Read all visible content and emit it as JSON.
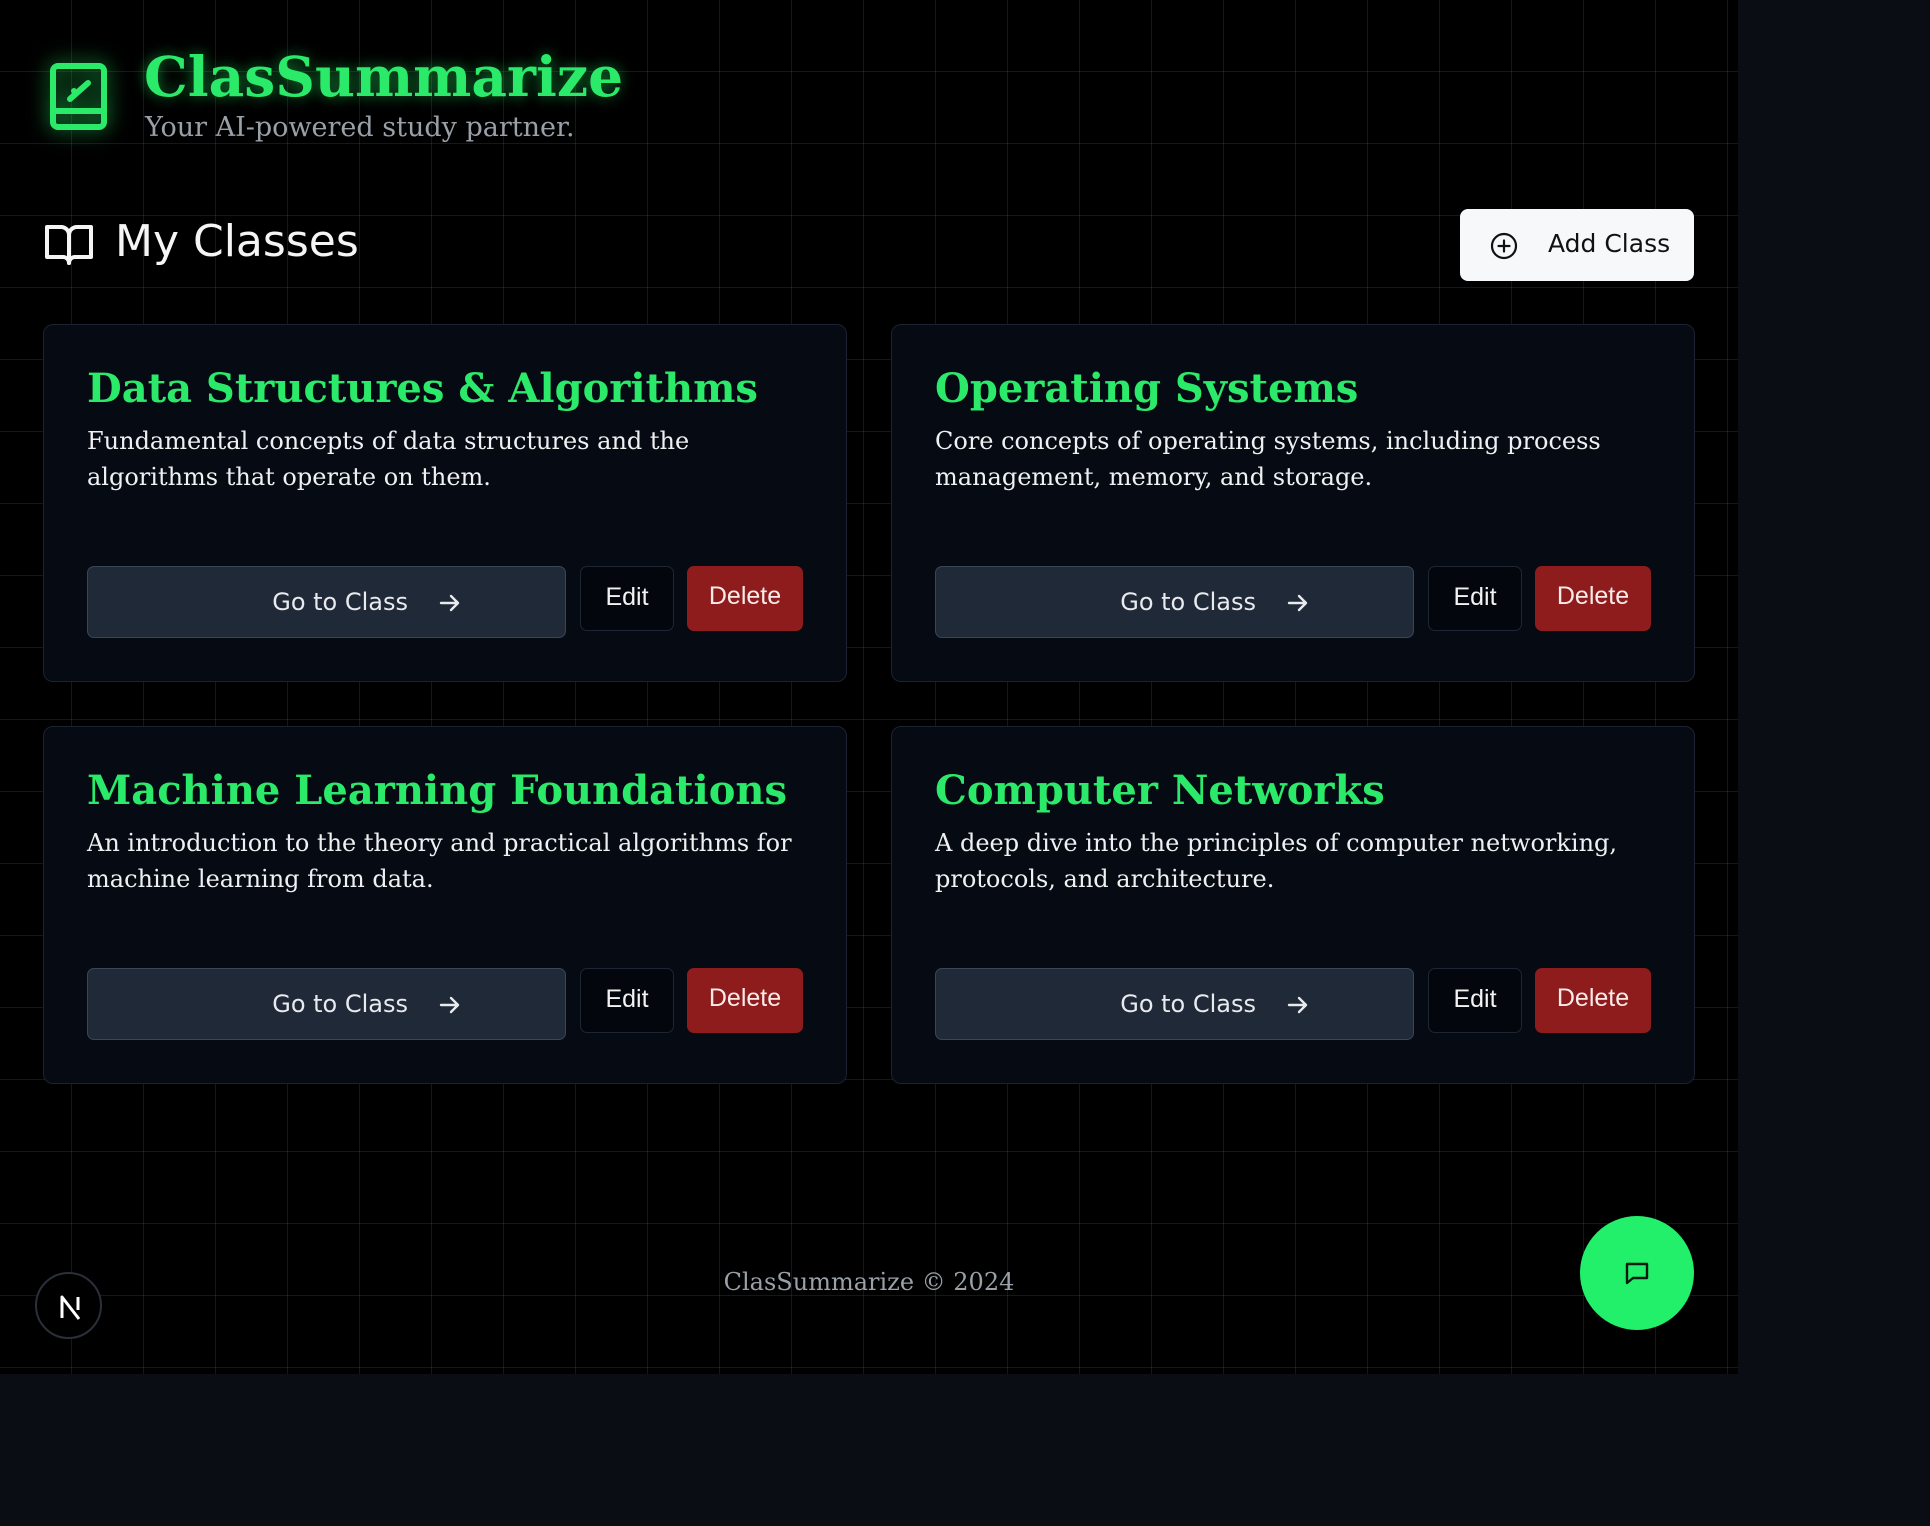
{
  "app": {
    "title": "ClasSummarize",
    "subtitle": "Your AI-powered study partner.",
    "logo_icon": "book-sparkle-icon"
  },
  "section": {
    "title": "My Classes",
    "icon": "open-book-icon",
    "add_button_label": "Add Class",
    "add_button_icon": "plus-circle-icon"
  },
  "classes": [
    {
      "title": "Data Structures & Algorithms",
      "description": "Fundamental concepts of data structures and the algorithms that operate on them.",
      "go_label": "Go to Class",
      "edit_label": "Edit",
      "delete_label": "Delete"
    },
    {
      "title": "Operating Systems",
      "description": "Core concepts of operating systems, including process management, memory, and storage.",
      "go_label": "Go to Class",
      "edit_label": "Edit",
      "delete_label": "Delete"
    },
    {
      "title": "Machine Learning Foundations",
      "description": "An introduction to the theory and practical algorithms for machine learning from data.",
      "go_label": "Go to Class",
      "edit_label": "Edit",
      "delete_label": "Delete"
    },
    {
      "title": "Computer Networks",
      "description": "A deep dive into the principles of computer networking, protocols, and architecture.",
      "go_label": "Go to Class",
      "edit_label": "Edit",
      "delete_label": "Delete"
    }
  ],
  "footer": {
    "text": "ClasSummarize © 2024"
  },
  "colors": {
    "accent": "#2bea6a",
    "delete": "#8e1c1c",
    "fab": "#22f06a"
  }
}
